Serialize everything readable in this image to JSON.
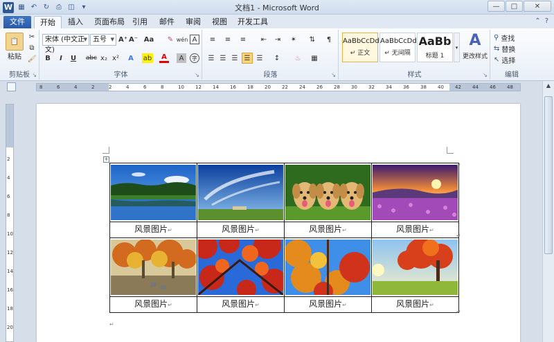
{
  "window": {
    "title": "文档1 - Microsoft Word",
    "app_logo": "W"
  },
  "quick_access": [
    "save-icon",
    "undo-icon",
    "redo-icon",
    "print-icon",
    "print-preview-icon",
    "customize-icon"
  ],
  "tabs": [
    "文件",
    "开始",
    "插入",
    "页面布局",
    "引用",
    "邮件",
    "审阅",
    "视图",
    "开发工具"
  ],
  "active_tab": "开始",
  "ribbon": {
    "clipboard": {
      "label": "剪贴板",
      "paste": "粘贴"
    },
    "font": {
      "label": "字体",
      "font_name": "宋体 (中文正文)",
      "font_size": "五号",
      "bold": "B",
      "italic": "I",
      "underline": "U",
      "strike": "abc",
      "sub": "x₂",
      "sup": "x²",
      "grow": "A⁺",
      "shrink": "A⁻",
      "change_case": "Aa",
      "clear": "✎",
      "phonetic": "wén",
      "border_char": "A",
      "effects": "A",
      "highlight": "ab",
      "font_color": "A",
      "shading": "A",
      "enclose": "字"
    },
    "paragraph": {
      "label": "段落"
    },
    "styles": {
      "label": "样式",
      "items": [
        {
          "sample": "AaBbCcDd",
          "name": "↵ 正文"
        },
        {
          "sample": "AaBbCcDd",
          "name": "↵ 无间隔"
        },
        {
          "sample": "AaBb",
          "name": "标题 1"
        }
      ],
      "change_styles": "更改样式"
    },
    "editing": {
      "label": "编辑",
      "find": "查找",
      "replace": "替换",
      "select": "选择"
    }
  },
  "ruler": {
    "h_numbers": [
      "8",
      "6",
      "4",
      "2",
      "2",
      "4",
      "6",
      "8",
      "10",
      "12",
      "14",
      "16",
      "18",
      "20",
      "22",
      "24",
      "26",
      "28",
      "30",
      "32",
      "34",
      "36",
      "38",
      "40",
      "42",
      "44",
      "46",
      "48"
    ],
    "v_numbers": [
      "2",
      "4",
      "6",
      "8",
      "10",
      "12",
      "14",
      "16",
      "18",
      "20"
    ]
  },
  "document": {
    "paragraph_mark": "↵",
    "captions": [
      [
        "风景图片",
        "风景图片",
        "风景图片",
        "风景图片"
      ],
      [
        "风景图片",
        "风景图片",
        "风景图片",
        "风景图片"
      ]
    ],
    "photos": [
      [
        "lake-forest-photo",
        "blue-sky-field-photo",
        "three-puppies-photo",
        "sunset-flower-field-photo"
      ],
      [
        "autumn-park-photo",
        "red-maple-sky-photo",
        "autumn-trees-photo",
        "red-tree-meadow-photo"
      ]
    ]
  },
  "colors": {
    "file_tab": "#2a5aa8",
    "ribbon_bg": "#f3f6fb",
    "style_selected": "#e8b24a"
  }
}
